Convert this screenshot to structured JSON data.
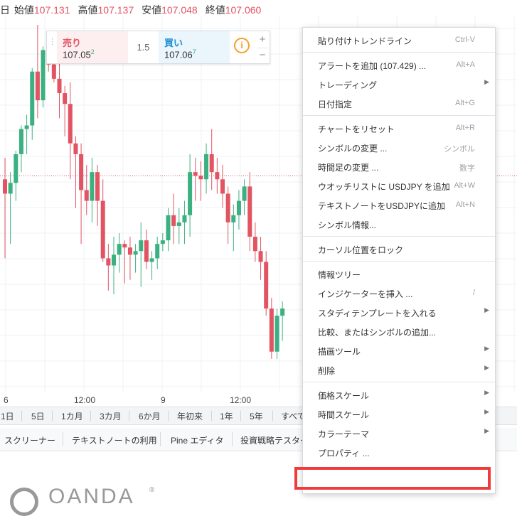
{
  "ohlc": {
    "prefix": "日",
    "open_label": "始値",
    "open": "107.131",
    "high_label": "高値",
    "high": "107.137",
    "low_label": "安値",
    "low": "107.048",
    "close_label": "終値",
    "close": "107.060"
  },
  "trade": {
    "sell_label": "売り",
    "sell_price": "107.05",
    "sell_pip": "2",
    "spread": "1.5",
    "buy_label": "買い",
    "buy_price": "107.06",
    "buy_pip": "7",
    "info_glyph": "i",
    "plus_glyph": "+",
    "minus_glyph": "−"
  },
  "xaxis": [
    "6",
    "12:00",
    "9",
    "12:00"
  ],
  "ranges": [
    "1日",
    "5日",
    "1カ月",
    "3カ月",
    "6か月",
    "年初来",
    "1年",
    "5年",
    "すべて"
  ],
  "tabs": [
    "スクリーナー",
    "テキストノートの利用",
    "Pine エディタ",
    "投資戦略テスター"
  ],
  "logo": {
    "text": "OANDA",
    "reg": "®"
  },
  "menu": {
    "groups": [
      [
        {
          "label": "貼り付けトレンドライン",
          "shortcut": "Ctrl-V",
          "arrow": false
        }
      ],
      [
        {
          "label": "アラートを追加 (107.429) ...",
          "shortcut": "Alt+A",
          "arrow": false
        },
        {
          "label": "トレーディング",
          "shortcut": "",
          "arrow": true
        },
        {
          "label": "日付指定",
          "shortcut": "Alt+G",
          "arrow": false
        }
      ],
      [
        {
          "label": "チャートをリセット",
          "shortcut": "Alt+R",
          "arrow": false
        },
        {
          "label": "シンボルの変更 ...",
          "shortcut": "シンボル",
          "arrow": false
        },
        {
          "label": "時間足の変更 ...",
          "shortcut": "数字",
          "arrow": false
        },
        {
          "label": "ウオッチリストに USDJPY を追加",
          "shortcut": "Alt+W",
          "arrow": false
        },
        {
          "label": "テキストノートをUSDJPYに追加",
          "shortcut": "Alt+N",
          "arrow": false
        },
        {
          "label": "シンボル情報...",
          "shortcut": "",
          "arrow": false
        }
      ],
      [
        {
          "label": "カーソル位置をロック",
          "shortcut": "",
          "arrow": false
        }
      ],
      [
        {
          "label": "情報ツリー",
          "shortcut": "",
          "arrow": false
        },
        {
          "label": "インジケーターを挿入 ...",
          "shortcut": "/",
          "arrow": false
        },
        {
          "label": "スタディテンプレートを入れる",
          "shortcut": "",
          "arrow": true
        },
        {
          "label": "比較、またはシンボルの追加...",
          "shortcut": "",
          "arrow": false
        },
        {
          "label": "描画ツール",
          "shortcut": "",
          "arrow": true
        },
        {
          "label": "削除",
          "shortcut": "",
          "arrow": true
        }
      ],
      [
        {
          "label": "価格スケール",
          "shortcut": "",
          "arrow": true
        },
        {
          "label": "時間スケール",
          "shortcut": "",
          "arrow": true
        },
        {
          "label": "カラーテーマ",
          "shortcut": "",
          "arrow": true
        },
        {
          "label": "プロパティ ...",
          "shortcut": "",
          "arrow": false
        }
      ]
    ]
  },
  "colors": {
    "up": "#3bb081",
    "down": "#e25462",
    "highlight": "#ef3b3b"
  },
  "chart_data": {
    "type": "candlestick",
    "candles": [
      {
        "o": 106.78,
        "h": 106.84,
        "l": 106.56,
        "c": 106.74
      },
      {
        "o": 106.74,
        "h": 106.8,
        "l": 106.6,
        "c": 106.77
      },
      {
        "o": 106.77,
        "h": 106.86,
        "l": 106.72,
        "c": 106.85
      },
      {
        "o": 106.85,
        "h": 106.93,
        "l": 106.8,
        "c": 106.92
      },
      {
        "o": 106.92,
        "h": 106.96,
        "l": 106.85,
        "c": 106.93
      },
      {
        "o": 106.93,
        "h": 107.09,
        "l": 106.89,
        "c": 107.08
      },
      {
        "o": 107.08,
        "h": 107.21,
        "l": 106.95,
        "c": 107.0
      },
      {
        "o": 107.0,
        "h": 107.15,
        "l": 106.98,
        "c": 107.14
      },
      {
        "o": 107.14,
        "h": 107.16,
        "l": 107.08,
        "c": 107.1
      },
      {
        "o": 107.1,
        "h": 107.18,
        "l": 107.05,
        "c": 107.06
      },
      {
        "o": 107.06,
        "h": 107.15,
        "l": 106.95,
        "c": 107.02
      },
      {
        "o": 107.02,
        "h": 107.04,
        "l": 106.9,
        "c": 106.99
      },
      {
        "o": 106.99,
        "h": 107.05,
        "l": 106.78,
        "c": 106.88
      },
      {
        "o": 106.88,
        "h": 106.9,
        "l": 106.7,
        "c": 106.85
      },
      {
        "o": 106.85,
        "h": 106.88,
        "l": 106.6,
        "c": 106.75
      },
      {
        "o": 106.75,
        "h": 106.82,
        "l": 106.68,
        "c": 106.72
      },
      {
        "o": 106.72,
        "h": 106.84,
        "l": 106.66,
        "c": 106.8
      },
      {
        "o": 106.8,
        "h": 106.82,
        "l": 106.65,
        "c": 106.72
      },
      {
        "o": 106.72,
        "h": 106.78,
        "l": 106.55,
        "c": 106.56
      },
      {
        "o": 106.56,
        "h": 106.6,
        "l": 106.47,
        "c": 106.54
      },
      {
        "o": 106.54,
        "h": 106.62,
        "l": 106.46,
        "c": 106.57
      },
      {
        "o": 106.57,
        "h": 106.63,
        "l": 106.52,
        "c": 106.6
      },
      {
        "o": 106.6,
        "h": 106.61,
        "l": 106.49,
        "c": 106.59
      },
      {
        "o": 106.59,
        "h": 106.62,
        "l": 106.5,
        "c": 106.57
      },
      {
        "o": 106.57,
        "h": 106.6,
        "l": 106.52,
        "c": 106.58
      },
      {
        "o": 106.58,
        "h": 106.66,
        "l": 106.48,
        "c": 106.61
      },
      {
        "o": 106.61,
        "h": 106.64,
        "l": 106.53,
        "c": 106.55
      },
      {
        "o": 106.55,
        "h": 106.58,
        "l": 106.5,
        "c": 106.56
      },
      {
        "o": 106.56,
        "h": 106.62,
        "l": 106.53,
        "c": 106.6
      },
      {
        "o": 106.6,
        "h": 106.63,
        "l": 106.58,
        "c": 106.61
      },
      {
        "o": 106.61,
        "h": 106.7,
        "l": 106.58,
        "c": 106.68
      },
      {
        "o": 106.68,
        "h": 106.74,
        "l": 106.6,
        "c": 106.65
      },
      {
        "o": 106.65,
        "h": 106.7,
        "l": 106.6,
        "c": 106.66
      },
      {
        "o": 106.66,
        "h": 106.72,
        "l": 106.6,
        "c": 106.68
      },
      {
        "o": 106.68,
        "h": 106.85,
        "l": 106.62,
        "c": 106.8
      },
      {
        "o": 106.8,
        "h": 106.84,
        "l": 106.72,
        "c": 106.79
      },
      {
        "o": 106.79,
        "h": 106.83,
        "l": 106.72,
        "c": 106.78
      },
      {
        "o": 106.78,
        "h": 106.88,
        "l": 106.74,
        "c": 106.85
      },
      {
        "o": 106.85,
        "h": 106.92,
        "l": 106.75,
        "c": 106.8
      },
      {
        "o": 106.8,
        "h": 106.84,
        "l": 106.74,
        "c": 106.78
      },
      {
        "o": 106.78,
        "h": 106.82,
        "l": 106.7,
        "c": 106.74
      },
      {
        "o": 106.74,
        "h": 106.76,
        "l": 106.6,
        "c": 106.66
      },
      {
        "o": 106.66,
        "h": 106.71,
        "l": 106.58,
        "c": 106.68
      },
      {
        "o": 106.68,
        "h": 106.75,
        "l": 106.64,
        "c": 106.72
      },
      {
        "o": 106.72,
        "h": 106.78,
        "l": 106.68,
        "c": 106.76
      },
      {
        "o": 106.76,
        "h": 106.8,
        "l": 106.58,
        "c": 106.62
      },
      {
        "o": 106.62,
        "h": 106.66,
        "l": 106.55,
        "c": 106.58
      },
      {
        "o": 106.58,
        "h": 106.62,
        "l": 106.5,
        "c": 106.55
      },
      {
        "o": 106.55,
        "h": 106.58,
        "l": 106.4,
        "c": 106.42
      },
      {
        "o": 106.42,
        "h": 106.45,
        "l": 106.28,
        "c": 106.3
      },
      {
        "o": 106.3,
        "h": 106.42,
        "l": 106.28,
        "c": 106.4
      },
      {
        "o": 106.4,
        "h": 106.44,
        "l": 106.33,
        "c": 106.42
      }
    ],
    "reference_line": 106.79,
    "ylim": [
      106.25,
      107.22
    ]
  }
}
